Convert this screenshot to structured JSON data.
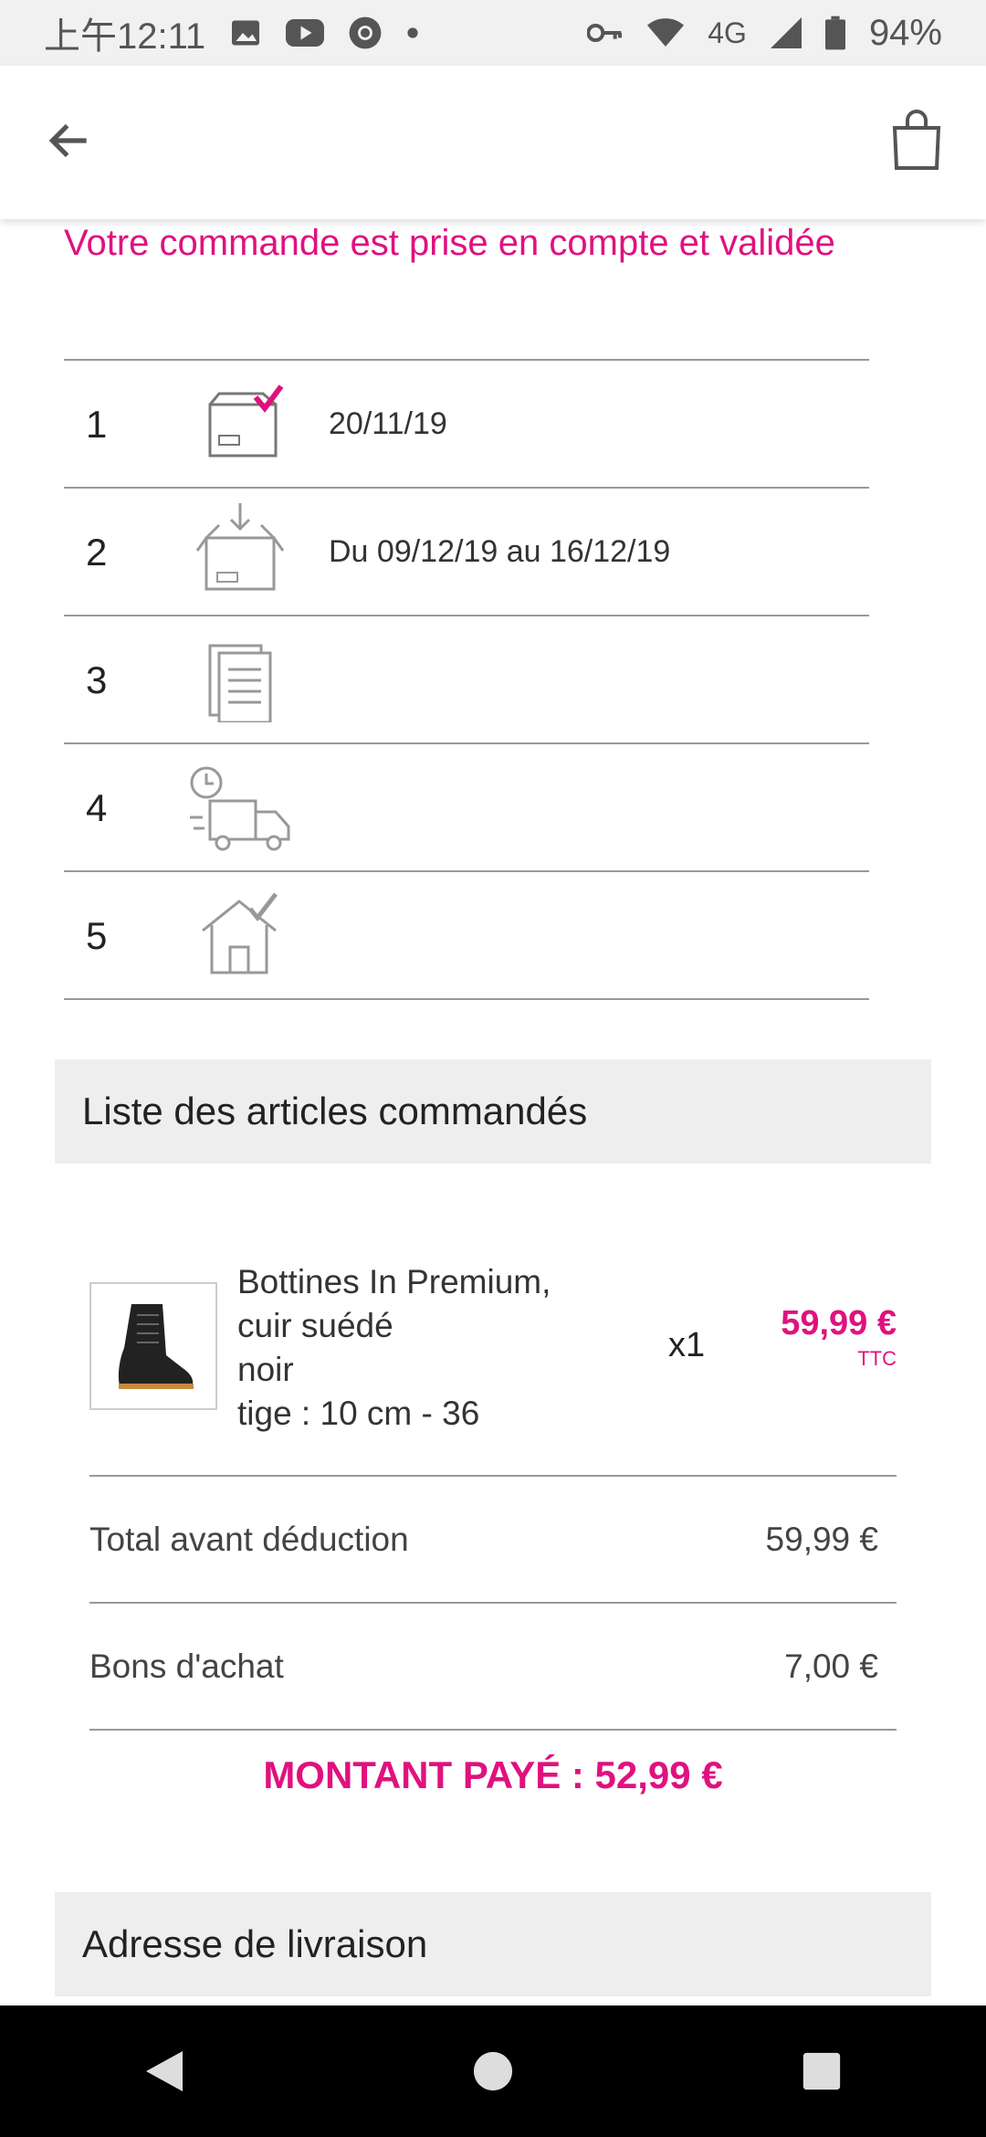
{
  "status_bar": {
    "time": "上午12:11",
    "network": "4G",
    "battery": "94%"
  },
  "header": {
    "back_icon": "arrow-left-icon",
    "bag_icon": "shopping-bag-icon"
  },
  "order": {
    "headline": "Votre commande est prise en compte et validée",
    "steps": [
      {
        "number": "1",
        "icon": "box-check-icon",
        "date": "20/11/19"
      },
      {
        "number": "2",
        "icon": "box-incoming-icon",
        "date": "Du 09/12/19 au 16/12/19"
      },
      {
        "number": "3",
        "icon": "documents-icon",
        "date": ""
      },
      {
        "number": "4",
        "icon": "delivery-truck-icon",
        "date": ""
      },
      {
        "number": "5",
        "icon": "house-check-icon",
        "date": ""
      }
    ]
  },
  "articles": {
    "title": "Liste des articles commandés",
    "items": [
      {
        "name_line1": "Bottines In Premium,",
        "name_line2": "cuir suédé",
        "color": "noir",
        "size": "tige : 10 cm - 36",
        "quantity": "x1",
        "price": "59,99 €",
        "price_suffix": "TTC"
      }
    ],
    "totals": {
      "before_label": "Total avant déduction",
      "before_value": "59,99 €",
      "voucher_label": "Bons d'achat",
      "voucher_value": "7,00 €",
      "paid": "MONTANT PAYÉ : 52,99 €"
    }
  },
  "delivery": {
    "title": "Adresse de livraison"
  },
  "colors": {
    "accent": "#e0117f",
    "section_bg": "#eeeeee"
  }
}
